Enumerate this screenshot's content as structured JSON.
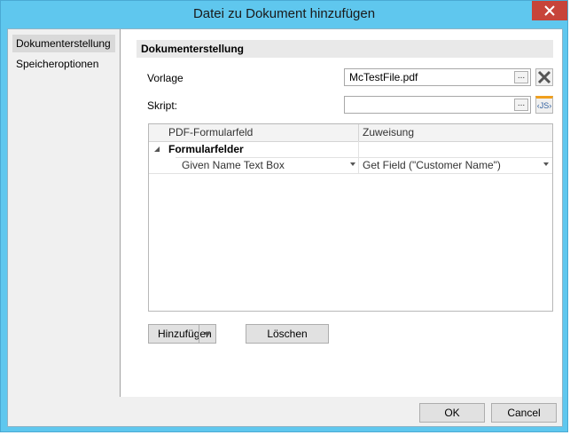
{
  "window": {
    "title": "Datei zu Dokument hinzufügen"
  },
  "sidebar": {
    "items": [
      {
        "label": "Dokumenterstellung",
        "selected": true
      },
      {
        "label": "Speicheroptionen",
        "selected": false
      }
    ]
  },
  "main": {
    "section_title": "Dokumenterstellung",
    "vorlage": {
      "label": "Vorlage",
      "value": "McTestFile.pdf",
      "browse_label": "..."
    },
    "skript": {
      "label": "Skript:",
      "value": "",
      "browse_label": "...",
      "js_label": "‹JS›"
    },
    "grid": {
      "columns": [
        "PDF-Formularfeld",
        "Zuweisung"
      ],
      "group_label": "Formularfelder",
      "rows": [
        {
          "field": "Given Name Text Box",
          "assignment": "Get Field (\"Customer Name\")"
        }
      ]
    },
    "add_button": "Hinzufügen",
    "delete_button": "Löschen"
  },
  "footer": {
    "ok_label": "OK",
    "cancel_label": "Cancel"
  },
  "colors": {
    "titlebar": "#5fc7ee",
    "close": "#c7443a",
    "selected_nav": "#d9d9d9",
    "js_accent": "#f0a01e"
  }
}
